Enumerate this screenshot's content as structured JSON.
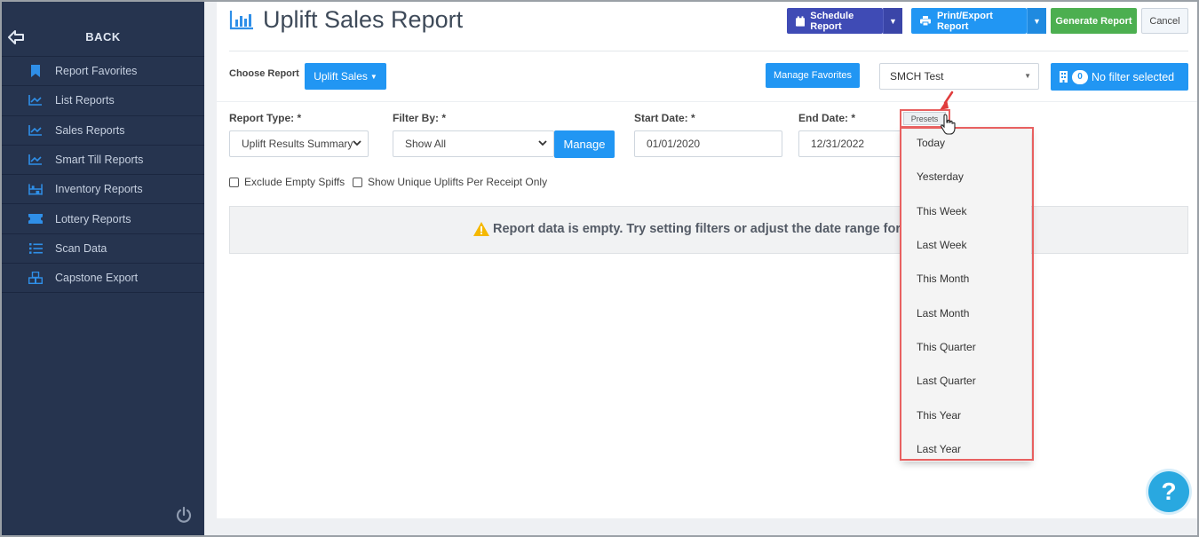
{
  "sidebar": {
    "back_label": "BACK",
    "items": [
      {
        "label": "Report Favorites",
        "icon": "bookmark-icon"
      },
      {
        "label": "List Reports",
        "icon": "line-chart-icon"
      },
      {
        "label": "Sales Reports",
        "icon": "line-chart-icon"
      },
      {
        "label": "Smart Till Reports",
        "icon": "line-chart-icon"
      },
      {
        "label": "Inventory Reports",
        "icon": "inventory-icon"
      },
      {
        "label": "Lottery Reports",
        "icon": "ticket-icon"
      },
      {
        "label": "Scan Data",
        "icon": "list-icon"
      },
      {
        "label": "Capstone Export",
        "icon": "boxes-icon"
      }
    ]
  },
  "header": {
    "title": "Uplift Sales Report",
    "schedule_label": "Schedule Report",
    "print_label": "Print/Export Report",
    "generate_label": "Generate Report",
    "cancel_label": "Cancel"
  },
  "toolbar": {
    "choose_label": "Choose Report",
    "report_button": "Uplift Sales",
    "manage_favorites": "Manage Favorites",
    "store_value": "SMCH Test",
    "filter_count": "0",
    "filter_label": "No filter selected"
  },
  "filters": {
    "report_type_label": "Report Type: *",
    "report_type_value": "Uplift Results Summary",
    "filter_by_label": "Filter By: *",
    "filter_by_value": "Show All",
    "manage_label": "Manage",
    "start_label": "Start Date: *",
    "start_value": "01/01/2020",
    "end_label": "End Date: *",
    "end_value": "12/31/2022",
    "exclude_label": "Exclude Empty Spiffs",
    "unique_label": "Show Unique Uplifts Per Receipt Only"
  },
  "alert": {
    "text": "Report data is empty. Try setting filters or adjust the date range for r"
  },
  "presets": {
    "button_label": "Presets",
    "options": [
      "Today",
      "Yesterday",
      "This Week",
      "Last Week",
      "This Month",
      "Last Month",
      "This Quarter",
      "Last Quarter",
      "This Year",
      "Last Year"
    ]
  },
  "help_label": "?",
  "colors": {
    "sidebar_bg": "#26344f",
    "primary": "#2196f3",
    "schedule": "#3f4bb5",
    "generate": "#4caf50",
    "highlight": "#e86060"
  }
}
